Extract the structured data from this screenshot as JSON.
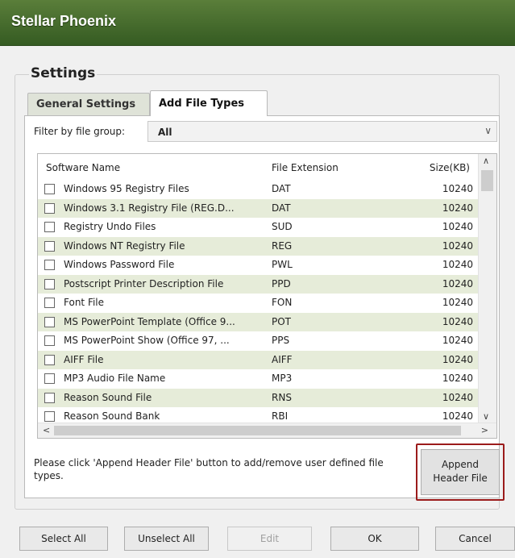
{
  "window": {
    "title": "Stellar Phoenix"
  },
  "settings_group": {
    "label": "Settings"
  },
  "tabs": [
    {
      "label": "General Settings",
      "active": false
    },
    {
      "label": "Add File Types",
      "active": true
    }
  ],
  "filter": {
    "label": "Filter by file group:",
    "value": "All"
  },
  "table": {
    "columns": [
      "Software Name",
      "File Extension",
      "Size(KB)"
    ],
    "rows": [
      {
        "name": "Windows 95 Registry Files",
        "ext": "DAT",
        "size": "10240",
        "checked": false
      },
      {
        "name": "Windows 3.1 Registry File (REG.D...",
        "ext": "DAT",
        "size": "10240",
        "checked": false
      },
      {
        "name": "Registry Undo Files",
        "ext": "SUD",
        "size": "10240",
        "checked": false
      },
      {
        "name": "Windows NT Registry File",
        "ext": "REG",
        "size": "10240",
        "checked": false
      },
      {
        "name": "Windows Password File",
        "ext": "PWL",
        "size": "10240",
        "checked": false
      },
      {
        "name": "Postscript Printer Description File",
        "ext": "PPD",
        "size": "10240",
        "checked": false
      },
      {
        "name": "Font File",
        "ext": "FON",
        "size": "10240",
        "checked": false
      },
      {
        "name": "MS PowerPoint Template (Office 9...",
        "ext": "POT",
        "size": "10240",
        "checked": false
      },
      {
        "name": "MS PowerPoint Show (Office 97, ...",
        "ext": "PPS",
        "size": "10240",
        "checked": false
      },
      {
        "name": "AIFF File",
        "ext": "AIFF",
        "size": "10240",
        "checked": false
      },
      {
        "name": "MP3 Audio File Name",
        "ext": "MP3",
        "size": "10240",
        "checked": false
      },
      {
        "name": "Reason Sound File",
        "ext": "RNS",
        "size": "10240",
        "checked": false
      },
      {
        "name": "Reason Sound Bank",
        "ext": "RBI",
        "size": "10240",
        "checked": false
      }
    ]
  },
  "note": "Please click 'Append Header File' button to add/remove user defined file types.",
  "append_button": {
    "line1": "Append",
    "line2": "Header File"
  },
  "buttons": {
    "select_all": "Select All",
    "unselect_all": "Unselect All",
    "edit": "Edit",
    "ok": "OK",
    "cancel": "Cancel"
  },
  "colors": {
    "titlebar": "#355b22",
    "row_alt": "#e6ecd9",
    "highlight": "#9b1b1b"
  },
  "icons": {
    "dropdown": "chevron-down-icon",
    "scroll_up": "chevron-up-icon",
    "scroll_down": "chevron-down-icon",
    "scroll_left": "chevron-left-icon",
    "scroll_right": "chevron-right-icon"
  }
}
